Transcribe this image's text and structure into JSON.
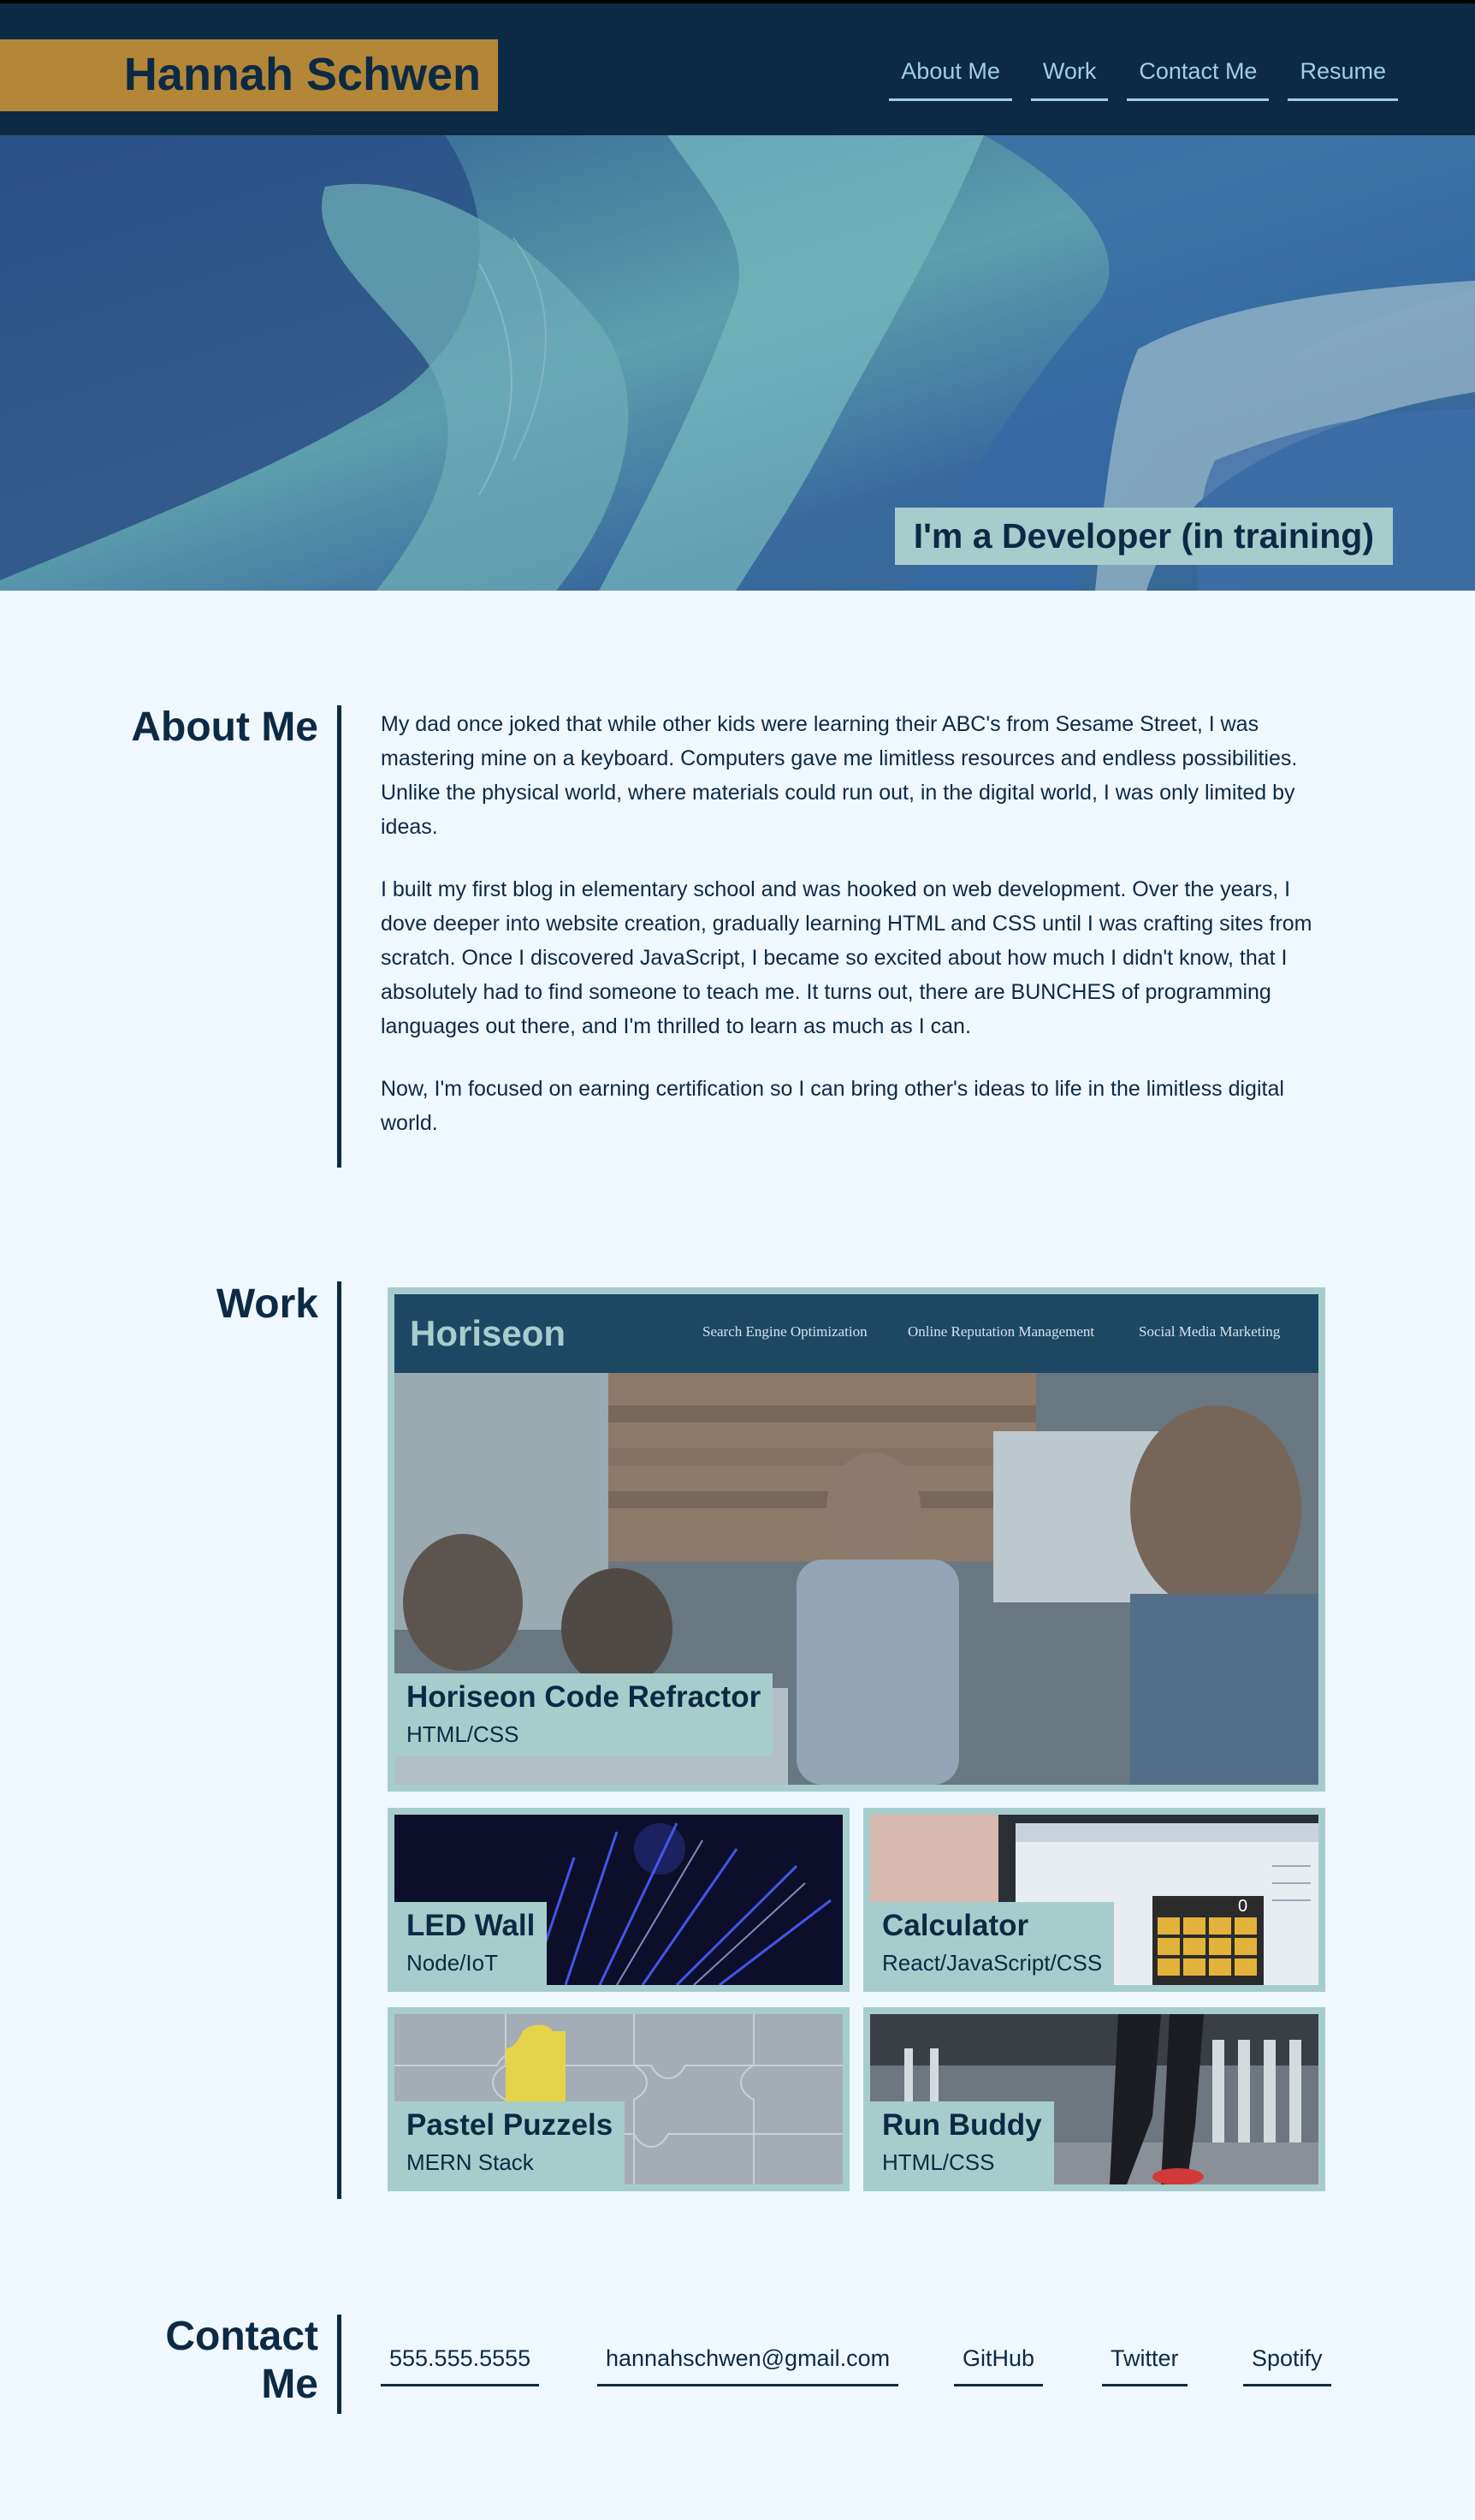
{
  "header": {
    "brand": "Hannah Schwen",
    "nav": [
      "About Me",
      "Work",
      "Contact Me",
      "Resume"
    ]
  },
  "hero": {
    "tagline": "I'm a Developer (in training)"
  },
  "about": {
    "title": "About Me",
    "paragraphs": [
      "My dad once joked that while other kids were learning their ABC's from Sesame Street, I was mastering mine on a keyboard. Computers gave me limitless resources and endless possibilities. Unlike the physical world, where materials could run out, in the digital world, I was only limited by ideas.",
      "I built my first blog in elementary school and was hooked on web development. Over the years, I dove deeper into website creation, gradually learning HTML and CSS until I was crafting sites from scratch. Once I discovered JavaScript, I became so excited about how much I didn't know, that I absolutely had to find someone to teach me. It turns out, there are BUNCHES of programming languages out there, and I'm thrilled to learn as much as I can.",
      "Now, I'm focused on earning certification so I can bring other's ideas to life in the limitless digital world."
    ]
  },
  "work": {
    "title": "Work",
    "featured": {
      "title": "Horiseon Code Refractor",
      "tech": "HTML/CSS",
      "screenshot": {
        "logo": "Horiseon",
        "nav": [
          "Search Engine Optimization",
          "Online Reputation Management",
          "Social Media Marketing"
        ]
      }
    },
    "projects": [
      {
        "title": "LED Wall",
        "tech": "Node/IoT"
      },
      {
        "title": "Calculator",
        "tech": "React/JavaScript/CSS"
      },
      {
        "title": "Pastel Puzzels",
        "tech": "MERN Stack"
      },
      {
        "title": "Run Buddy",
        "tech": "HTML/CSS"
      }
    ],
    "calculator_display": "0"
  },
  "contact": {
    "title": "Contact Me",
    "links": [
      "555.555.5555",
      "hannahschwen@gmail.com",
      "GitHub",
      "Twitter",
      "Spotify"
    ]
  },
  "colors": {
    "navy": "#0c2a44",
    "gold": "#b38737",
    "teal": "#a6cdcc",
    "background": "#eff7ff",
    "nav_link": "#a3cfe0"
  }
}
